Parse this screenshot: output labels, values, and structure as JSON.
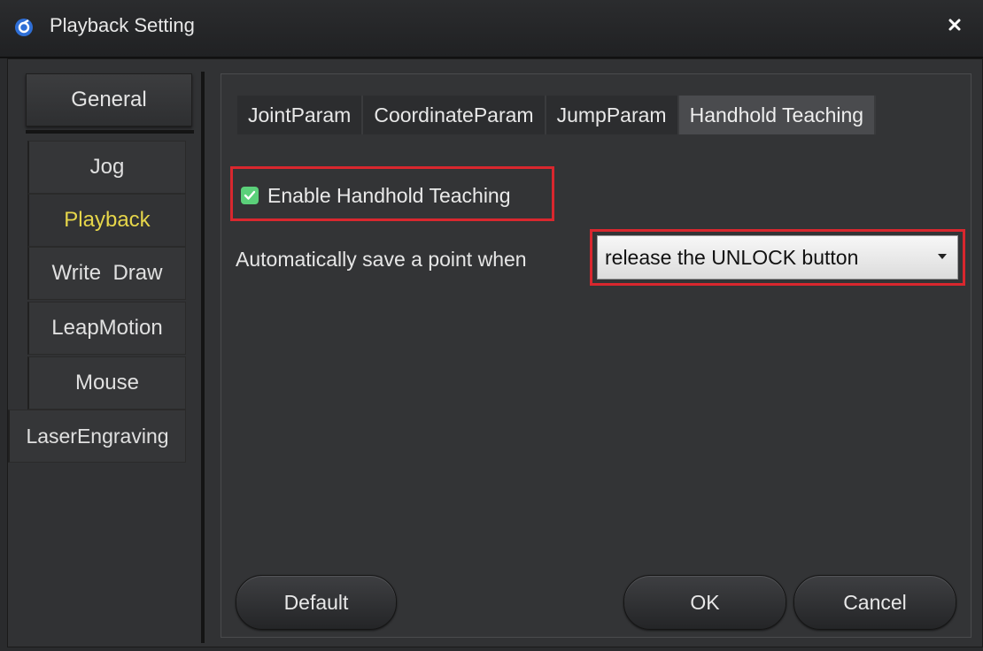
{
  "window": {
    "title": "Playback Setting"
  },
  "sidebar": {
    "general": "General",
    "items": [
      {
        "label": "Jog",
        "active": false
      },
      {
        "label": "Playback",
        "active": true
      },
      {
        "label": "Write  Draw",
        "active": false
      },
      {
        "label": "LeapMotion",
        "active": false
      },
      {
        "label": "Mouse",
        "active": false
      },
      {
        "label": "LaserEngraving",
        "active": false
      }
    ]
  },
  "tabs": [
    {
      "label": "JointParam",
      "active": false
    },
    {
      "label": "CoordinateParam",
      "active": false
    },
    {
      "label": "JumpParam",
      "active": false
    },
    {
      "label": "Handhold Teaching",
      "active": true
    }
  ],
  "handhold": {
    "enable_label": "Enable Handhold Teaching",
    "enable_checked": true,
    "auto_save_label": "Automatically save a point when",
    "auto_save_value": "release the UNLOCK button"
  },
  "buttons": {
    "default": "Default",
    "ok": "OK",
    "cancel": "Cancel"
  },
  "colors": {
    "highlight_box": "#d9272e",
    "active_sidebar_text": "#e6d64a",
    "checkbox": "#5bd07a"
  }
}
